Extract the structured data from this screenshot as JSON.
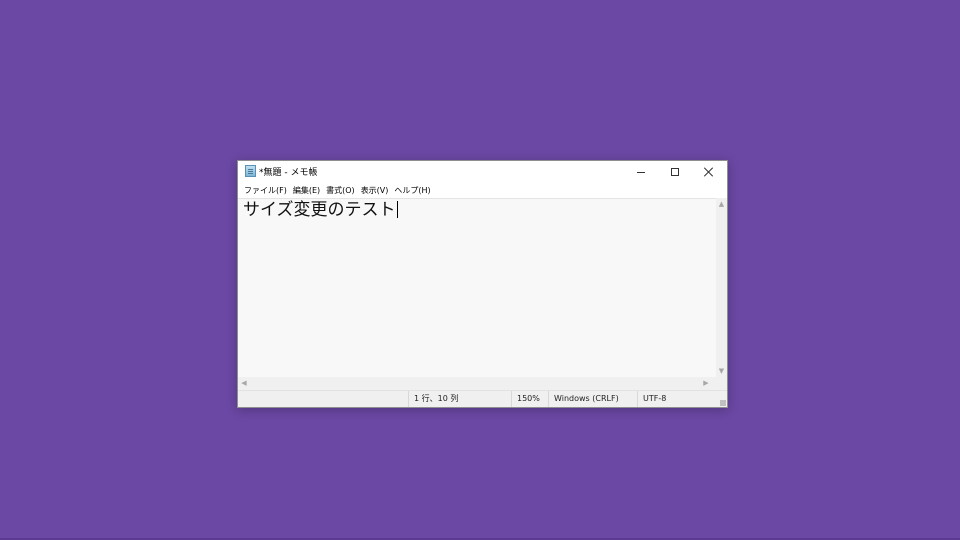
{
  "window": {
    "title": "*無題 - メモ帳",
    "controls": {
      "minimize_icon": "minimize-icon",
      "maximize_icon": "maximize-icon",
      "close_icon": "close-icon"
    }
  },
  "menu": {
    "items": [
      {
        "label": "ファイル(F)"
      },
      {
        "label": "編集(E)"
      },
      {
        "label": "書式(O)"
      },
      {
        "label": "表示(V)"
      },
      {
        "label": "ヘルプ(H)"
      }
    ]
  },
  "editor": {
    "content": "サイズ変更のテスト"
  },
  "statusbar": {
    "position": "1 行、10 列",
    "zoom": "150%",
    "line_ending": "Windows (CRLF)",
    "encoding": "UTF-8"
  },
  "colors": {
    "desktop": "#6b48a4",
    "editor_bg": "#f8f8f8",
    "chrome": "#f0f0f0"
  }
}
